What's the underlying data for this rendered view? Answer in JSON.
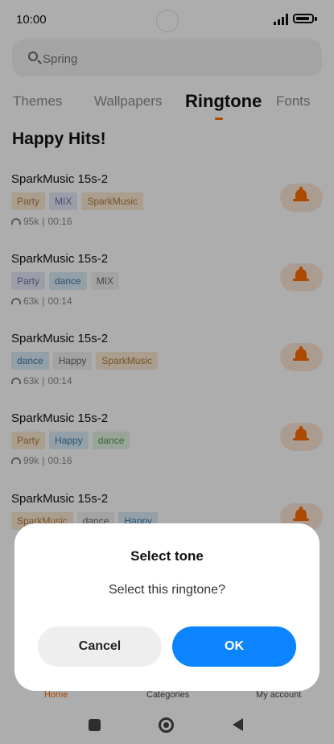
{
  "status": {
    "time": "10:00"
  },
  "search": {
    "placeholder": "Spring"
  },
  "tabs": [
    {
      "label": "Themes"
    },
    {
      "label": "Wallpapers"
    },
    {
      "label": "Ringtone"
    },
    {
      "label": "Fonts"
    }
  ],
  "section_title": "Happy Hits!",
  "items": [
    {
      "title": "SparkMusic 15s-2",
      "tags": [
        "Party",
        "MIX",
        "SparkMusic"
      ],
      "plays": "95k",
      "duration": "00:16"
    },
    {
      "title": "SparkMusic 15s-2",
      "tags": [
        "Party",
        "dance",
        "MIX"
      ],
      "plays": "63k",
      "duration": "00:14"
    },
    {
      "title": "SparkMusic 15s-2",
      "tags": [
        "dance",
        "Happy",
        "SparkMusic"
      ],
      "plays": "63k",
      "duration": "00:14"
    },
    {
      "title": "SparkMusic 15s-2",
      "tags": [
        "Party",
        "Happy",
        "dance"
      ],
      "plays": "99k",
      "duration": "00:16"
    },
    {
      "title": "SparkMusic 15s-2",
      "tags": [
        "SparkMusic",
        "dance",
        "Happy"
      ]
    }
  ],
  "bottom_nav": [
    {
      "label": "Home"
    },
    {
      "label": "Categories"
    },
    {
      "label": "My account"
    }
  ],
  "dialog": {
    "title": "Select tone",
    "message": "Select this ringtone?",
    "cancel_label": "Cancel",
    "ok_label": "OK"
  },
  "colors": {
    "accent": "#ff6a00",
    "primary_button": "#0d84ff"
  }
}
